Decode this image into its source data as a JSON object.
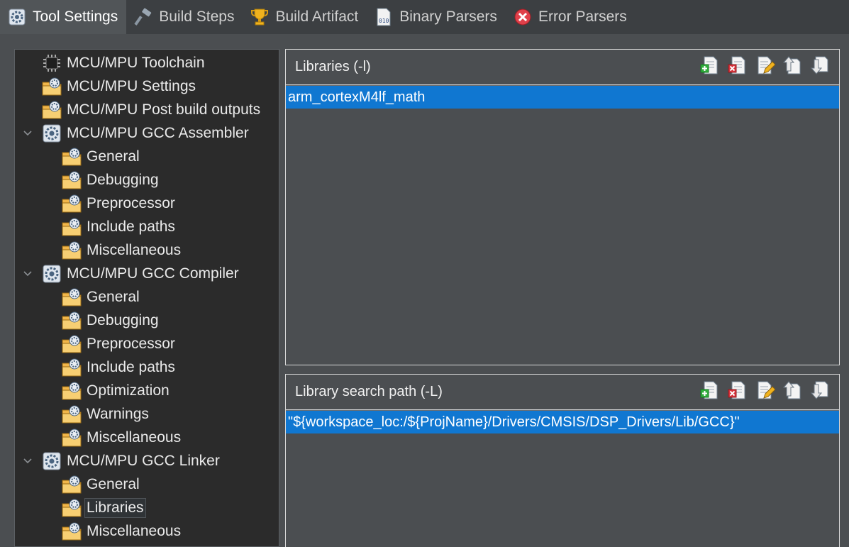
{
  "tabs": [
    {
      "label": "Tool Settings",
      "icon": "gear-icon",
      "active": true
    },
    {
      "label": "Build Steps",
      "icon": "hammer-icon",
      "active": false
    },
    {
      "label": "Build Artifact",
      "icon": "trophy-icon",
      "active": false
    },
    {
      "label": "Binary Parsers",
      "icon": "binary-file-icon",
      "active": false
    },
    {
      "label": "Error Parsers",
      "icon": "error-icon",
      "active": false
    }
  ],
  "tree": [
    {
      "label": "MCU/MPU Toolchain",
      "level": 0,
      "icon": "chip-icon",
      "expandable": false,
      "selected": false
    },
    {
      "label": "MCU/MPU Settings",
      "level": 0,
      "icon": "folder-settings-icon",
      "expandable": false,
      "selected": false
    },
    {
      "label": "MCU/MPU Post build outputs",
      "level": 0,
      "icon": "folder-settings-icon",
      "expandable": false,
      "selected": false
    },
    {
      "label": "MCU/MPU GCC Assembler",
      "level": 0,
      "icon": "tool-gear-icon",
      "expandable": true,
      "selected": false
    },
    {
      "label": "General",
      "level": 1,
      "icon": "folder-settings-icon",
      "expandable": false,
      "selected": false
    },
    {
      "label": "Debugging",
      "level": 1,
      "icon": "folder-settings-icon",
      "expandable": false,
      "selected": false
    },
    {
      "label": "Preprocessor",
      "level": 1,
      "icon": "folder-settings-icon",
      "expandable": false,
      "selected": false
    },
    {
      "label": "Include paths",
      "level": 1,
      "icon": "folder-settings-icon",
      "expandable": false,
      "selected": false
    },
    {
      "label": "Miscellaneous",
      "level": 1,
      "icon": "folder-settings-icon",
      "expandable": false,
      "selected": false
    },
    {
      "label": "MCU/MPU GCC Compiler",
      "level": 0,
      "icon": "tool-gear-icon",
      "expandable": true,
      "selected": false
    },
    {
      "label": "General",
      "level": 1,
      "icon": "folder-settings-icon",
      "expandable": false,
      "selected": false
    },
    {
      "label": "Debugging",
      "level": 1,
      "icon": "folder-settings-icon",
      "expandable": false,
      "selected": false
    },
    {
      "label": "Preprocessor",
      "level": 1,
      "icon": "folder-settings-icon",
      "expandable": false,
      "selected": false
    },
    {
      "label": "Include paths",
      "level": 1,
      "icon": "folder-settings-icon",
      "expandable": false,
      "selected": false
    },
    {
      "label": "Optimization",
      "level": 1,
      "icon": "folder-settings-icon",
      "expandable": false,
      "selected": false
    },
    {
      "label": "Warnings",
      "level": 1,
      "icon": "folder-settings-icon",
      "expandable": false,
      "selected": false
    },
    {
      "label": "Miscellaneous",
      "level": 1,
      "icon": "folder-settings-icon",
      "expandable": false,
      "selected": false
    },
    {
      "label": "MCU/MPU GCC Linker",
      "level": 0,
      "icon": "tool-gear-icon",
      "expandable": true,
      "selected": false
    },
    {
      "label": "General",
      "level": 1,
      "icon": "folder-settings-icon",
      "expandable": false,
      "selected": false
    },
    {
      "label": "Libraries",
      "level": 1,
      "icon": "folder-settings-icon",
      "expandable": false,
      "selected": true
    },
    {
      "label": "Miscellaneous",
      "level": 1,
      "icon": "folder-settings-icon",
      "expandable": false,
      "selected": false
    }
  ],
  "libraries_panel": {
    "title": "Libraries (-l)",
    "items": [
      "arm_cortexM4lf_math"
    ]
  },
  "search_path_panel": {
    "title": "Library search path (-L)",
    "items": [
      "\"${workspace_loc:/${ProjName}/Drivers/CMSIS/DSP_Drivers/Lib/GCC}\""
    ]
  },
  "panel_tools": [
    {
      "name": "add-icon"
    },
    {
      "name": "delete-icon"
    },
    {
      "name": "edit-icon"
    },
    {
      "name": "move-up-icon"
    },
    {
      "name": "move-down-icon"
    }
  ],
  "colors": {
    "selection": "#1077d1",
    "tree_background": "#2b2b2b",
    "window_background": "#4b4e51"
  }
}
